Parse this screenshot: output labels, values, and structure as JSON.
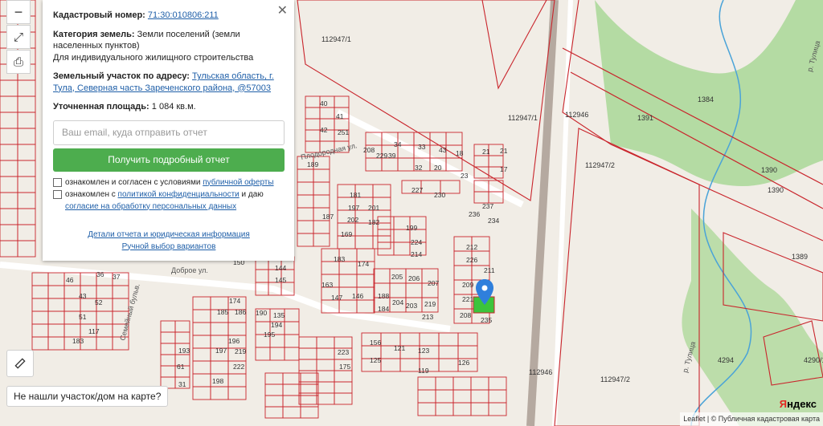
{
  "panel": {
    "cadastral_label": "Кадастровый номер:",
    "cadastral_number": "71:30:010806:211",
    "category_label": "Категория земель:",
    "category_value": "Земли поселений (земли населенных пунктов)",
    "category_use": "Для индивидуального жилищного строительства",
    "address_label": "Земельный участок по адресу:",
    "address_value": "Тульская область, г. Тула, Северная часть Зареченского района, @57003",
    "area_label": "Уточненная площадь:",
    "area_value": "1 084 кв.м.",
    "email_placeholder": "Ваш email, куда отправить отчет",
    "report_button": "Получить подробный отчет",
    "offer_text": "ознакомлен и согласен с условиями ",
    "offer_link": "публичной оферты",
    "privacy_text1": "ознакомлен с ",
    "privacy_link": "политикой конфиденциальности",
    "privacy_text2": " и даю",
    "consent_link": "согласие на обработку персональных данных",
    "details_link": "Детали отчета и юридическая информация",
    "manual_link": "Ручной выбор вариантов",
    "close": "✕"
  },
  "controls": {
    "zoom_out": "−",
    "expand": "⤢",
    "print": "⎙",
    "not_found": "Не нашли участок/дом на карте?"
  },
  "map_labels": {
    "lots": [
      "112947/1",
      "112947/1",
      "112946",
      "112947/2",
      "1384",
      "1391",
      "1390",
      "1390",
      "1389",
      "4294",
      "4290/1",
      "112946",
      "112947/2"
    ],
    "parcels": [
      "40",
      "41",
      "42",
      "251",
      "34",
      "33",
      "43",
      "18",
      "21",
      "21",
      "17",
      "39",
      "32",
      "20",
      "23",
      "208",
      "229",
      "227",
      "230",
      "181",
      "197",
      "202",
      "201",
      "182",
      "169",
      "187",
      "189",
      "199",
      "236",
      "234",
      "237",
      "212",
      "226",
      "211",
      "209",
      "221",
      "208",
      "235",
      "183",
      "174",
      "163",
      "147",
      "146",
      "205",
      "206",
      "204",
      "203",
      "219",
      "207",
      "213",
      "224",
      "214",
      "188",
      "184",
      "145",
      "144",
      "150",
      "46",
      "43",
      "52",
      "51",
      "36",
      "37",
      "183",
      "117",
      "185",
      "186",
      "190",
      "195",
      "194",
      "197",
      "198",
      "196",
      "219",
      "222",
      "223",
      "175",
      "156",
      "121",
      "123",
      "125",
      "119",
      "126",
      "135",
      "174",
      "193",
      "61",
      "31",
      "30",
      "29"
    ],
    "streets": [
      "Плодородная ул.",
      "Доброе ул.",
      "Семейный бульв.",
      "р. Тулица",
      "р. Тулица"
    ]
  },
  "brand": {
    "prefix": "Я",
    "name": "ндекс"
  },
  "attribution": "Leaflet | © Публичная кадастровая карта",
  "colors": {
    "parcel": "#c9252c",
    "button": "#4dad4e",
    "marker": "#2f7fdc",
    "selected": "#3cc43c",
    "river_green": "#9ad08a"
  }
}
